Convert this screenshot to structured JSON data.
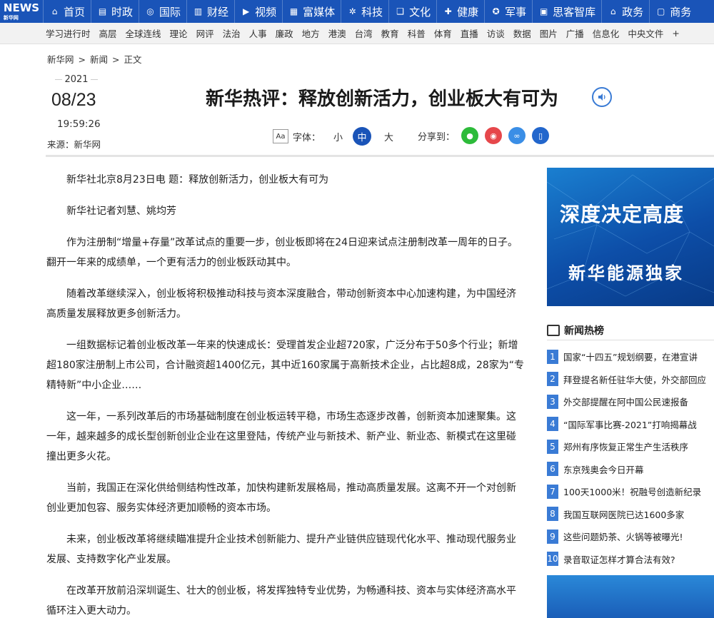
{
  "logo": {
    "text": "NEWS",
    "sub": "新华网"
  },
  "topnav": [
    {
      "label": "首页",
      "icon": "home-icon",
      "glyph": "⌂"
    },
    {
      "label": "时政",
      "icon": "news-icon",
      "glyph": "▤"
    },
    {
      "label": "国际",
      "icon": "globe-icon",
      "glyph": "◎"
    },
    {
      "label": "财经",
      "icon": "chart-icon",
      "glyph": "▥"
    },
    {
      "label": "视频",
      "icon": "video-icon",
      "glyph": "▶"
    },
    {
      "label": "富媒体",
      "icon": "grid-icon",
      "glyph": "▦"
    },
    {
      "label": "科技",
      "icon": "atom-icon",
      "glyph": "✲"
    },
    {
      "label": "文化",
      "icon": "book-icon",
      "glyph": "❑"
    },
    {
      "label": "健康",
      "icon": "health-icon",
      "glyph": "✚"
    },
    {
      "label": "军事",
      "icon": "military-icon",
      "glyph": "✪"
    },
    {
      "label": "思客智库",
      "icon": "think-icon",
      "glyph": "▣"
    },
    {
      "label": "政务",
      "icon": "gov-icon",
      "glyph": "⌂"
    },
    {
      "label": "商务",
      "icon": "business-icon",
      "glyph": "▢"
    }
  ],
  "subnav": [
    "学习进行时",
    "高层",
    "全球连线",
    "理论",
    "网评",
    "法治",
    "人事",
    "廉政",
    "地方",
    "港澳",
    "台湾",
    "教育",
    "科普",
    "体育",
    "直播",
    "访谈",
    "数据",
    "图片",
    "广播",
    "信息化",
    "中央文件",
    "+"
  ],
  "breadcrumb": [
    "新华网",
    ">",
    "新闻",
    ">",
    "正文"
  ],
  "meta": {
    "year": "2021",
    "date": "08/23",
    "time": "19:59:26",
    "source": "来源：新华网"
  },
  "title": "新华热评：释放创新活力，创业板大有可为",
  "font": {
    "label": "字体：",
    "aa": "Aa",
    "small": "小",
    "medium": "中",
    "large": "大"
  },
  "share": {
    "label": "分享到："
  },
  "article": [
    "新华社北京8月23日电 题：释放创新活力，创业板大有可为",
    "新华社记者刘慧、姚均芳",
    "作为注册制“增量+存量”改革试点的重要一步，创业板即将在24日迎来试点注册制改革一周年的日子。翻开一年来的成绩单，一个更有活力的创业板跃动其中。",
    "随着改革继续深入，创业板将积极推动科技与资本深度融合，带动创新资本中心加速构建，为中国经济高质量发展释放更多创新活力。",
    "一组数据标记着创业板改革一年来的快速成长：受理首发企业超720家，广泛分布于50多个行业；新增超180家注册制上市公司，合计融资超1400亿元，其中近160家属于高新技术企业，占比超8成，28家为“专精特新”中小企业……",
    "这一年，一系列改革后的市场基础制度在创业板运转平稳，市场生态逐步改善，创新资本加速聚集。这一年，越来越多的成长型创新创业企业在这里登陆，传统产业与新技术、新产业、新业态、新模式在这里碰撞出更多火花。",
    "当前，我国正在深化供给侧结构性改革，加快构建新发展格局，推动高质量发展。这离不开一个对创新创业更加包容、服务实体经济更加顺畅的资本市场。",
    "未来，创业板改革将继续瞄准提升企业技术创新能力、提升产业链供应链现代化水平、推动现代服务业发展、支持数字化产业发展。",
    "在改革开放前沿深圳诞生、壮大的创业板，将发挥独特专业优势，为畅通科技、资本与实体经济高水平循环注入更大动力。"
  ],
  "banner": {
    "line1": "深度决定高度",
    "line2": "新华能源独家"
  },
  "hot": {
    "title": "新闻热榜",
    "items": [
      {
        "n": "1",
        "text": "国家“十四五”规划纲要，在港宣讲"
      },
      {
        "n": "2",
        "text": "拜登提名新任驻华大使，外交部回应"
      },
      {
        "n": "3",
        "text": "外交部提醒在阿中国公民速报备"
      },
      {
        "n": "4",
        "text": "“国际军事比赛-2021”打响揭幕战"
      },
      {
        "n": "5",
        "text": "郑州有序恢复正常生产生活秩序"
      },
      {
        "n": "6",
        "text": "东京残奥会今日开幕"
      },
      {
        "n": "7",
        "text": "100天1000米！祝融号创造新纪录"
      },
      {
        "n": "8",
        "text": "我国互联网医院已达1600多家"
      },
      {
        "n": "9",
        "text": "这些问题奶茶、火锅等被曝光!"
      },
      {
        "n": "10",
        "text": "录音取证怎样才算合法有效?"
      }
    ]
  }
}
